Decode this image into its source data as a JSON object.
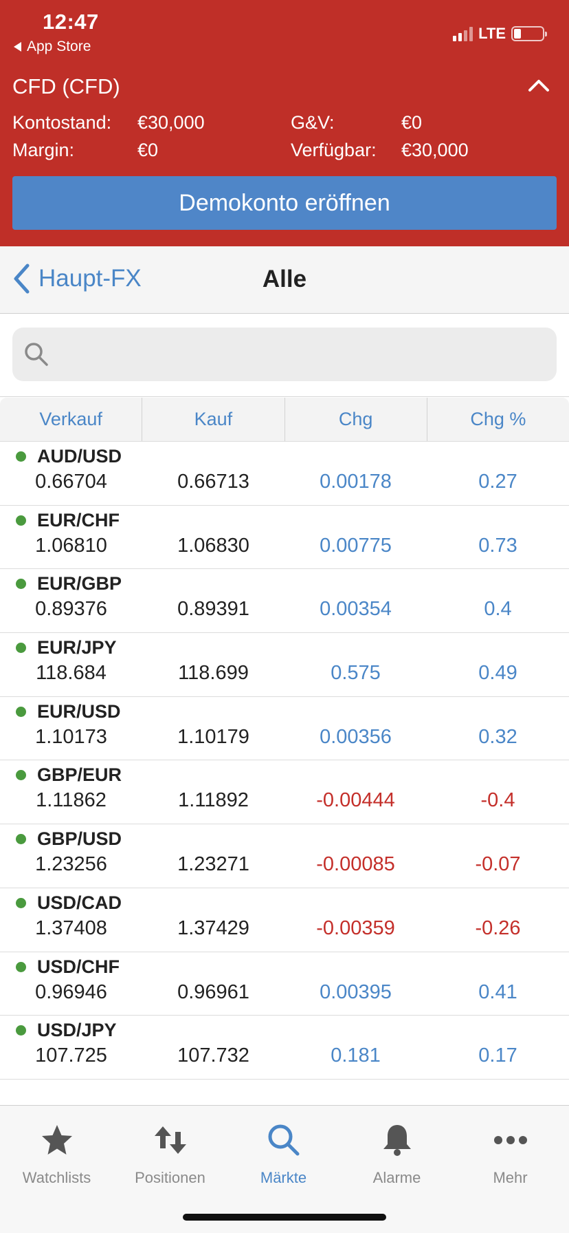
{
  "status_bar": {
    "time": "12:47",
    "back_app": "App Store",
    "network": "LTE"
  },
  "account": {
    "title": "CFD (CFD)",
    "balance_label": "Kontostand:",
    "balance_value": "€30,000",
    "pnl_label": "G&V:",
    "pnl_value": "€0",
    "margin_label": "Margin:",
    "margin_value": "€0",
    "available_label": "Verfügbar:",
    "available_value": "€30,000",
    "demo_button": "Demokonto eröffnen"
  },
  "nav": {
    "back_label": "Haupt-FX",
    "title": "Alle"
  },
  "search": {
    "placeholder": ""
  },
  "table": {
    "headers": [
      "Verkauf",
      "Kauf",
      "Chg",
      "Chg %"
    ],
    "rows": [
      {
        "symbol": "AUD/USD",
        "sell": "0.66704",
        "buy": "0.66713",
        "chg": "0.00178",
        "chg_pct": "0.27",
        "dir": "pos"
      },
      {
        "symbol": "EUR/CHF",
        "sell": "1.06810",
        "buy": "1.06830",
        "chg": "0.00775",
        "chg_pct": "0.73",
        "dir": "pos"
      },
      {
        "symbol": "EUR/GBP",
        "sell": "0.89376",
        "buy": "0.89391",
        "chg": "0.00354",
        "chg_pct": "0.4",
        "dir": "pos"
      },
      {
        "symbol": "EUR/JPY",
        "sell": "118.684",
        "buy": "118.699",
        "chg": "0.575",
        "chg_pct": "0.49",
        "dir": "pos"
      },
      {
        "symbol": "EUR/USD",
        "sell": "1.10173",
        "buy": "1.10179",
        "chg": "0.00356",
        "chg_pct": "0.32",
        "dir": "pos"
      },
      {
        "symbol": "GBP/EUR",
        "sell": "1.11862",
        "buy": "1.11892",
        "chg": "-0.00444",
        "chg_pct": "-0.4",
        "dir": "neg"
      },
      {
        "symbol": "GBP/USD",
        "sell": "1.23256",
        "buy": "1.23271",
        "chg": "-0.00085",
        "chg_pct": "-0.07",
        "dir": "neg"
      },
      {
        "symbol": "USD/CAD",
        "sell": "1.37408",
        "buy": "1.37429",
        "chg": "-0.00359",
        "chg_pct": "-0.26",
        "dir": "neg"
      },
      {
        "symbol": "USD/CHF",
        "sell": "0.96946",
        "buy": "0.96961",
        "chg": "0.00395",
        "chg_pct": "0.41",
        "dir": "pos"
      },
      {
        "symbol": "USD/JPY",
        "sell": "107.725",
        "buy": "107.732",
        "chg": "0.181",
        "chg_pct": "0.17",
        "dir": "pos"
      }
    ]
  },
  "tabbar": {
    "items": [
      {
        "label": "Watchlists",
        "icon": "star-icon"
      },
      {
        "label": "Positionen",
        "icon": "arrows-updown-icon"
      },
      {
        "label": "Märkte",
        "icon": "search-icon"
      },
      {
        "label": "Alarme",
        "icon": "bell-icon"
      },
      {
        "label": "Mehr",
        "icon": "more-icon"
      }
    ],
    "active_index": 2
  },
  "colors": {
    "header_red": "#bf2f28",
    "button_blue": "#4f86c8",
    "accent_blue": "#4a86c7",
    "negative_red": "#c42f2a",
    "status_dot_green": "#4a9a3e"
  }
}
